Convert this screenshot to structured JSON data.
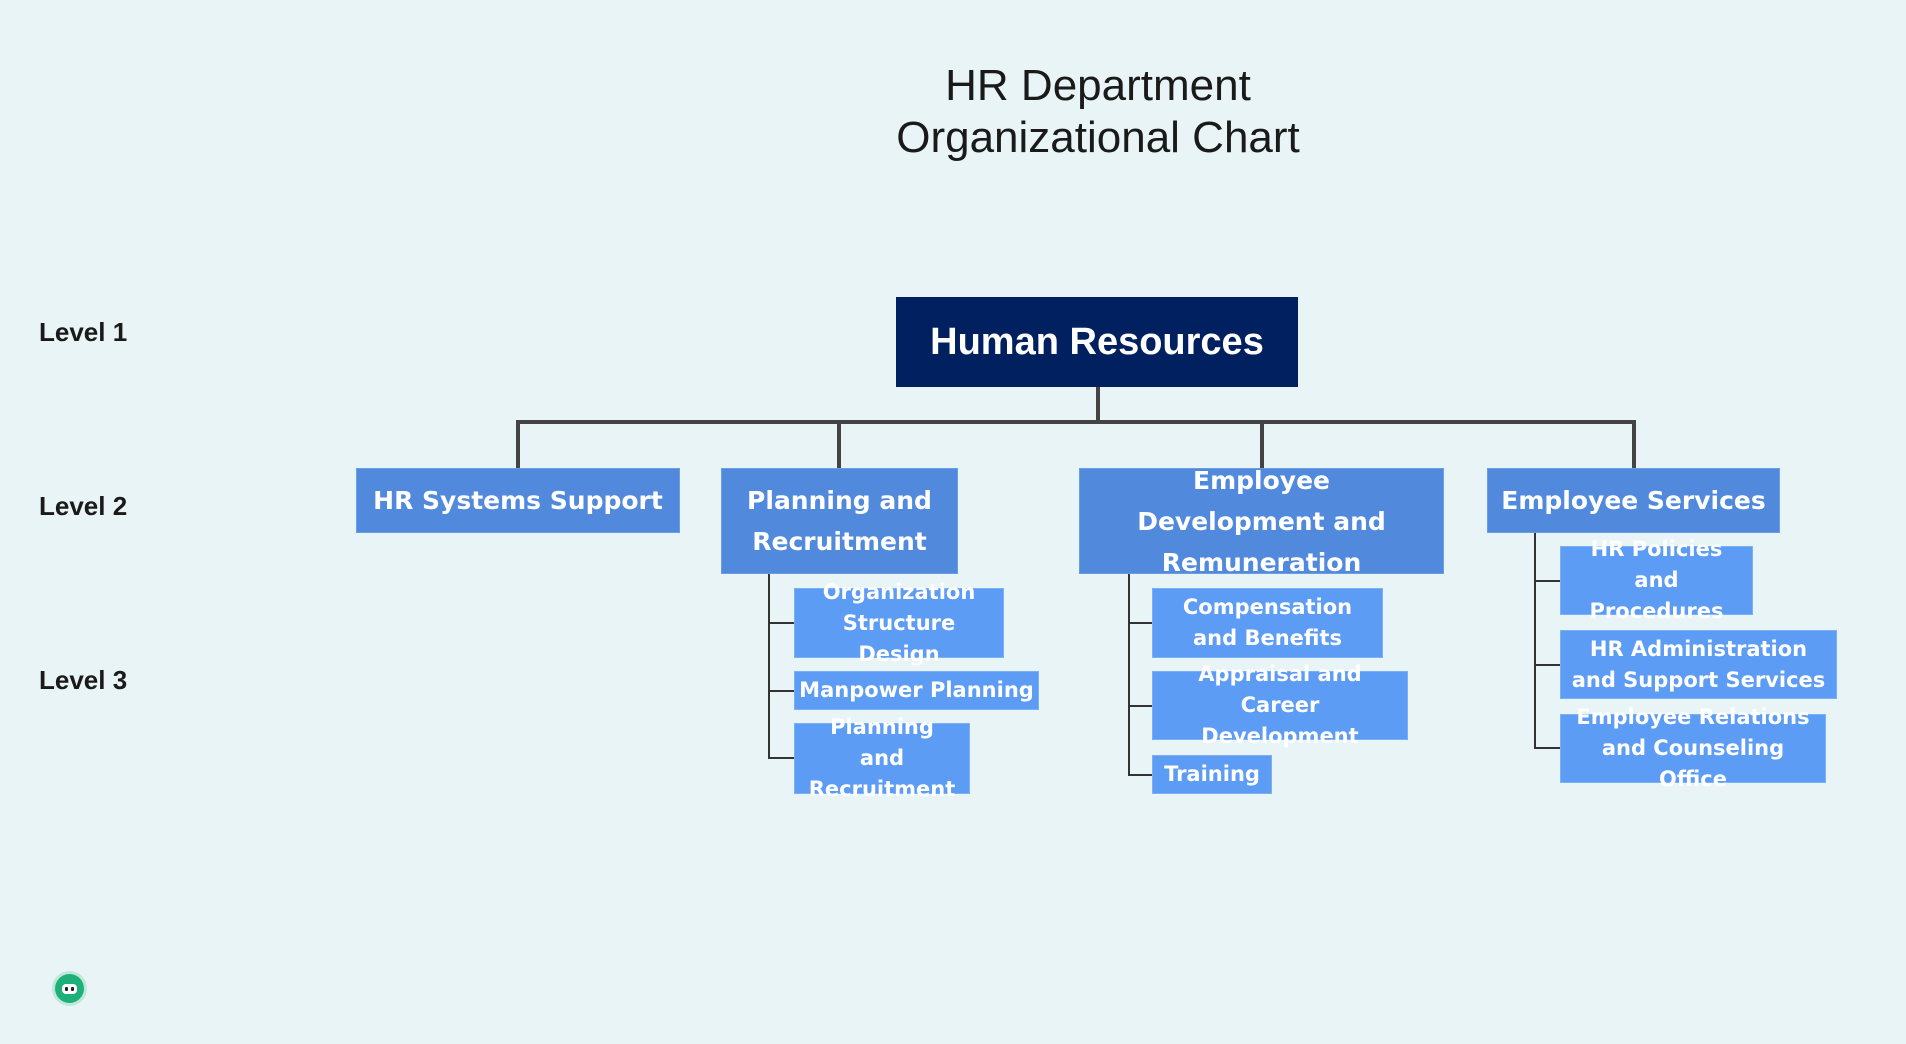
{
  "title": {
    "line1": "HR Department",
    "line2": "Organizational Chart"
  },
  "levels": [
    "Level 1",
    "Level 2",
    "Level 3"
  ],
  "root": {
    "label": "Human Resources",
    "color": "#00205f"
  },
  "colors": {
    "level2": "#5189dd",
    "level3": "#5c9cf5",
    "connector": "#444444",
    "background": "#e8f4f5"
  },
  "departments": [
    {
      "label": "HR Systems Support",
      "children": []
    },
    {
      "label": "Planning and Recruitment",
      "children": [
        "Organization Structure Design",
        "Manpower Planning",
        "Planning and Recruitment"
      ]
    },
    {
      "label": "Employee Development and Remuneration",
      "children": [
        "Compensation and Benefits",
        "Appraisal and Career Development",
        "Training"
      ]
    },
    {
      "label": "Employee Services",
      "children": [
        "HR Policies and Procedures",
        "HR Administration and Support Services",
        "Employee Relations and Counseling Office"
      ]
    }
  ],
  "assistant_icon": "chatbot-icon"
}
